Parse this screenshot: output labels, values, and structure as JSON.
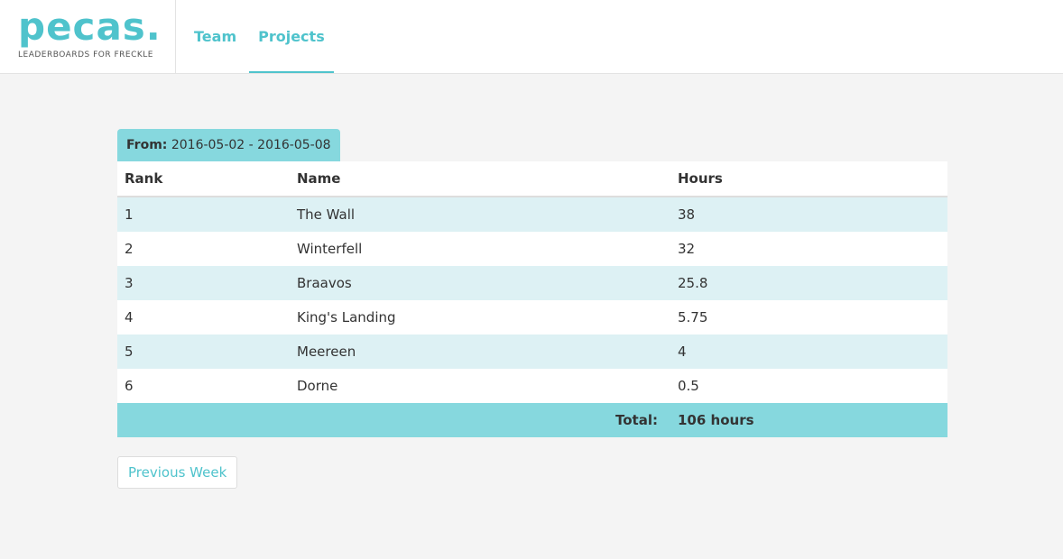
{
  "brand": {
    "logo": "pecas.",
    "tagline": "LEADERBOARDS FOR FRECKLE"
  },
  "nav": {
    "team": "Team",
    "projects": "Projects"
  },
  "period": {
    "label": "From:",
    "range": "2016-05-02 - 2016-05-08"
  },
  "table": {
    "headers": {
      "rank": "Rank",
      "name": "Name",
      "hours": "Hours"
    },
    "rows": [
      {
        "rank": "1",
        "name": "The Wall",
        "hours": "38"
      },
      {
        "rank": "2",
        "name": "Winterfell",
        "hours": "32"
      },
      {
        "rank": "3",
        "name": "Braavos",
        "hours": "25.8"
      },
      {
        "rank": "4",
        "name": "King's Landing",
        "hours": "5.75"
      },
      {
        "rank": "5",
        "name": "Meereen",
        "hours": "4"
      },
      {
        "rank": "6",
        "name": "Dorne",
        "hours": "0.5"
      }
    ],
    "total_label": "Total:",
    "total_value": "106 hours"
  },
  "buttons": {
    "previous_week": "Previous Week"
  },
  "colors": {
    "accent": "#4fc3cc",
    "header_band": "#86d8de",
    "row_alt": "#ddf1f4"
  }
}
